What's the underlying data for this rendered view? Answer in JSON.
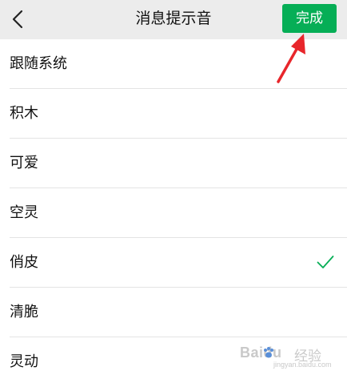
{
  "header": {
    "back_icon": "chevron-left-icon",
    "title": "消息提示音",
    "done_label": "完成",
    "done_color": "#06ae56"
  },
  "tones": [
    {
      "label": "跟随系统",
      "selected": false
    },
    {
      "label": "积木",
      "selected": false
    },
    {
      "label": "可爱",
      "selected": false
    },
    {
      "label": "空灵",
      "selected": false
    },
    {
      "label": "俏皮",
      "selected": true
    },
    {
      "label": "清脆",
      "selected": false
    },
    {
      "label": "灵动",
      "selected": false
    }
  ],
  "check_color": "#06ae56",
  "annotation": {
    "arrow_color": "#e8262b",
    "points_to": "done-button"
  },
  "watermark": {
    "brand": "Baidu",
    "cn": "经验",
    "url": "jingyan.baidu.com"
  }
}
